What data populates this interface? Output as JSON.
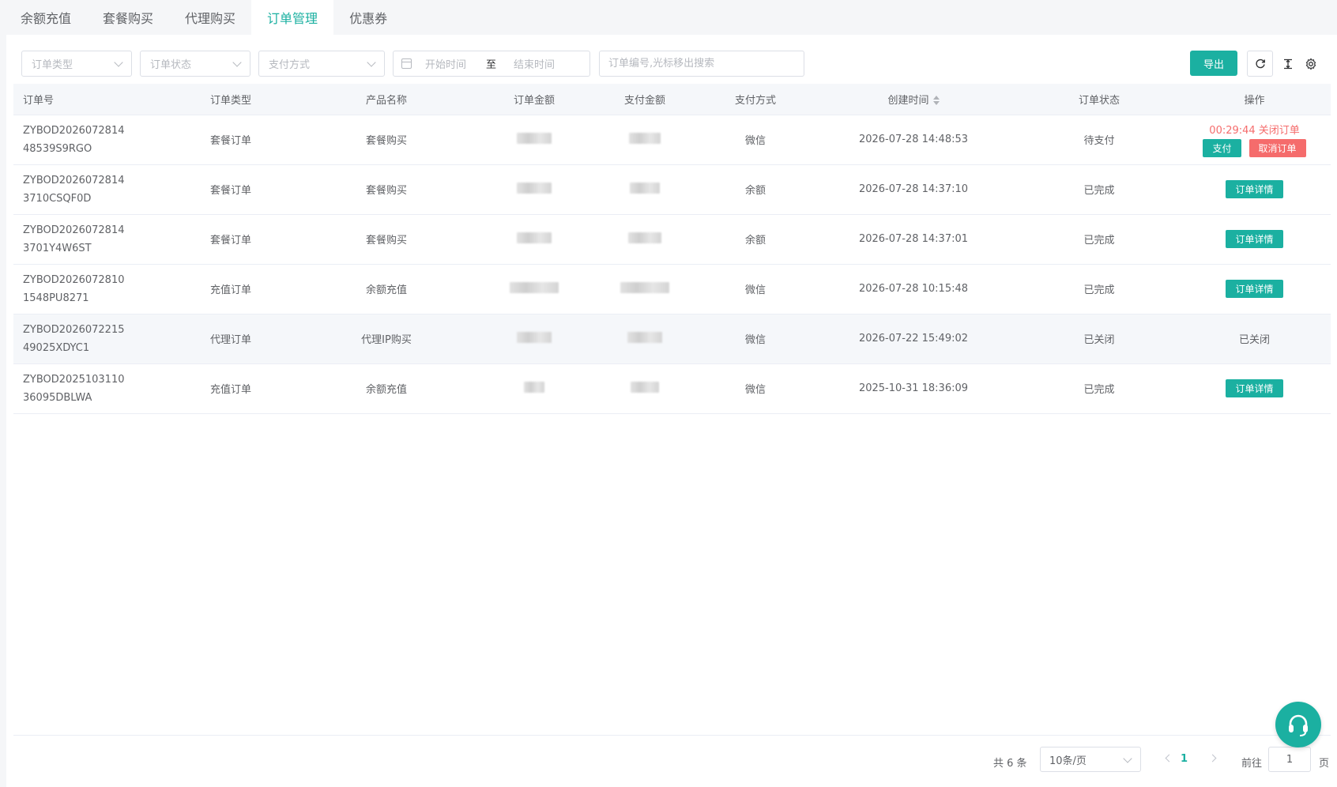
{
  "tabs": [
    {
      "label": "余额充值",
      "active": false
    },
    {
      "label": "套餐购买",
      "active": false
    },
    {
      "label": "代理购买",
      "active": false
    },
    {
      "label": "订单管理",
      "active": true
    },
    {
      "label": "优惠券",
      "active": false
    }
  ],
  "filters": {
    "order_type_placeholder": "订单类型",
    "order_status_placeholder": "订单状态",
    "pay_method_placeholder": "支付方式",
    "start_placeholder": "开始时间",
    "range_separator": "至",
    "end_placeholder": "结束时间",
    "search_placeholder": "订单编号,光标移出搜索"
  },
  "toolbar": {
    "export_label": "导出",
    "icons": [
      "refresh-icon",
      "column-height-icon",
      "settings-icon"
    ]
  },
  "table": {
    "columns": [
      "订单号",
      "订单类型",
      "产品名称",
      "订单金额",
      "支付金额",
      "支付方式",
      "创建时间",
      "订单状态",
      "操作"
    ],
    "sortable_column": "创建时间",
    "rows": [
      {
        "order_no_1": "ZYBOD2026072814",
        "order_no_2": "48539S9RGO",
        "type": "套餐订单",
        "product": "套餐购买",
        "pay_method": "微信",
        "created": "2026-07-28 14:48:53",
        "status": "待支付",
        "action": "pending",
        "countdown": "00:29:44",
        "close_label": "关闭订单",
        "pay_label": "支付",
        "cancel_label": "取消订单"
      },
      {
        "order_no_1": "ZYBOD2026072814",
        "order_no_2": "3710CSQF0D",
        "type": "套餐订单",
        "product": "套餐购买",
        "pay_method": "余额",
        "created": "2026-07-28 14:37:10",
        "status": "已完成",
        "action": "detail",
        "detail_label": "订单详情"
      },
      {
        "order_no_1": "ZYBOD2026072814",
        "order_no_2": "3701Y4W6ST",
        "type": "套餐订单",
        "product": "套餐购买",
        "pay_method": "余额",
        "created": "2026-07-28 14:37:01",
        "status": "已完成",
        "action": "detail",
        "detail_label": "订单详情"
      },
      {
        "order_no_1": "ZYBOD2026072810",
        "order_no_2": "1548PU8271",
        "type": "充值订单",
        "product": "余额充值",
        "pay_method": "微信",
        "created": "2026-07-28 10:15:48",
        "status": "已完成",
        "action": "detail",
        "detail_label": "订单详情"
      },
      {
        "order_no_1": "ZYBOD2026072215",
        "order_no_2": "49025XDYC1",
        "type": "代理订单",
        "product": "代理IP购买",
        "pay_method": "微信",
        "created": "2026-07-22 15:49:02",
        "status": "已关闭",
        "action": "closed",
        "closed_label": "已关闭"
      },
      {
        "order_no_1": "ZYBOD2025103110",
        "order_no_2": "36095DBLWA",
        "type": "充值订单",
        "product": "余额充值",
        "pay_method": "微信",
        "created": "2025-10-31 18:36:09",
        "status": "已完成",
        "action": "detail",
        "detail_label": "订单详情"
      }
    ]
  },
  "pagination": {
    "total_label": "共 6 条",
    "page_size": "10条/页",
    "current_page": "1",
    "goto_label": "前往",
    "goto_value": "1",
    "page_label": "页"
  },
  "colors": {
    "accent": "#1bb0a1",
    "danger": "#f56c6c"
  }
}
